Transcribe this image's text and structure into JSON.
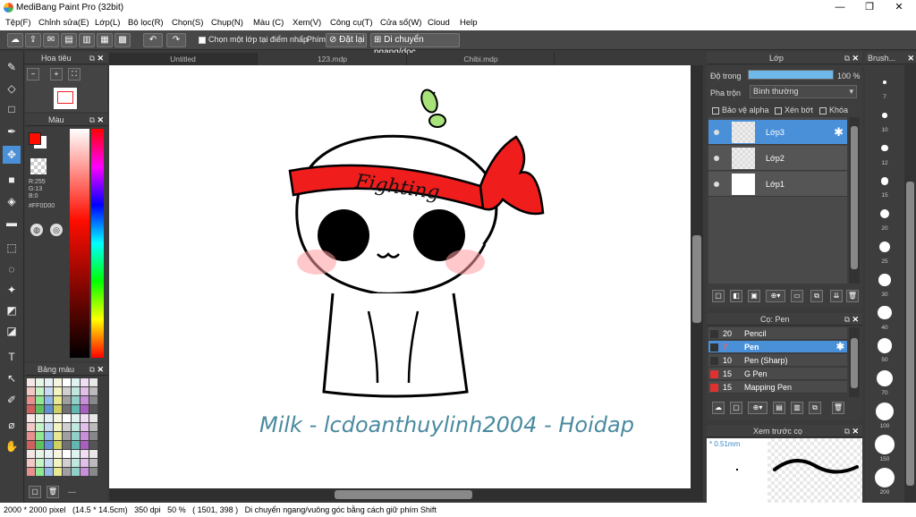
{
  "window": {
    "title": "MediBang Paint Pro (32bit)"
  },
  "menu": [
    "Tệp(F)",
    "Chỉnh sửa(E)",
    "Lớp(L)",
    "Bộ lọc(R)",
    "Chọn(S)",
    "Chụp(N)",
    "Màu (C)",
    "Xem(V)",
    "Công cụ(T)",
    "Cửa sổ(W)",
    "Cloud",
    "Help"
  ],
  "toolbar": {
    "select_layer_label": "Chọn một lớp tại điểm nhấp",
    "snap_label": "Phím",
    "reset_label": "Đặt lại",
    "move_label": "Di chuyển ngang/dọc"
  },
  "navigator": {
    "title": "Hoa tiêu"
  },
  "color_panel": {
    "title": "Màu",
    "r": "R:255",
    "g": "G:13",
    "b": "B:0",
    "hex": "#FF0D00",
    "fg": "#FF0D00",
    "bg": "#ffffff"
  },
  "palette_panel": {
    "title": "Bảng màu",
    "footer": "---"
  },
  "tabs": [
    "Untitled",
    "123.mdp",
    "Chibi.mdp"
  ],
  "artwork": {
    "headband_text": "Fighting",
    "caption": "Milk - lcdoanthuylinh2004 - Hoidap"
  },
  "layers": {
    "title": "Lớp",
    "opacity_label": "Độ trong",
    "opacity_value": "100 %",
    "opacity": 1.0,
    "blend_label": "Pha trộn",
    "blend_value": "Bình thường",
    "protect_alpha": "Bảo vệ alpha",
    "clip": "Xén bớt",
    "lock": "Khóa",
    "items": [
      {
        "name": "Lớp3",
        "selected": true
      },
      {
        "name": "Lớp2",
        "selected": false
      },
      {
        "name": "Lớp1",
        "selected": false
      }
    ]
  },
  "brush_panel": {
    "title": "Cọ: Pen",
    "items": [
      {
        "size": "20",
        "name": "Pencil",
        "color": "#333333",
        "selected": false
      },
      {
        "size": "7",
        "name": "Pen",
        "color": "#333333",
        "selected": true
      },
      {
        "size": "10",
        "name": "Pen (Sharp)",
        "color": "#333333",
        "selected": false
      },
      {
        "size": "15",
        "name": "G Pen",
        "color": "#e03030",
        "selected": false
      },
      {
        "size": "15",
        "name": "Mapping Pen",
        "color": "#e03030",
        "selected": false
      }
    ]
  },
  "preview": {
    "title": "Xem trước cọ",
    "size": "* 0.51mm"
  },
  "brush_sizes": {
    "title": "Brush...",
    "sizes": [
      "7",
      "10",
      "12",
      "15",
      "20",
      "25",
      "30",
      "40",
      "50",
      "70",
      "100",
      "150",
      "200"
    ]
  },
  "status": "2000 * 2000 pixel   (14.5 * 14.5cm)   350 dpi   50 %   ( 1501, 398 )   Di chuyển ngang/vuông góc bằng cách giữ phím Shift"
}
